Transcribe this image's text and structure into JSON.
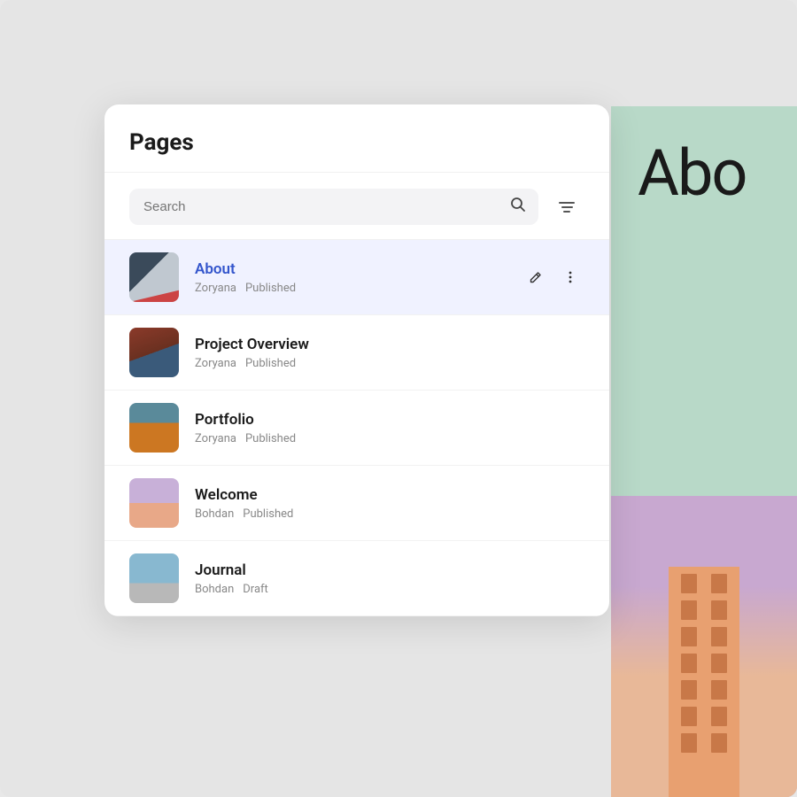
{
  "app": {
    "title": "Pages"
  },
  "search": {
    "placeholder": "Search",
    "value": ""
  },
  "pages": [
    {
      "id": "about",
      "name": "About",
      "author": "Zoryana",
      "status": "Published",
      "active": true,
      "thumbClass": "thumb-about"
    },
    {
      "id": "project-overview",
      "name": "Project Overview",
      "author": "Zoryana",
      "status": "Published",
      "active": false,
      "thumbClass": "thumb-project"
    },
    {
      "id": "portfolio",
      "name": "Portfolio",
      "author": "Zoryana",
      "status": "Published",
      "active": false,
      "thumbClass": "thumb-portfolio"
    },
    {
      "id": "welcome",
      "name": "Welcome",
      "author": "Bohdan",
      "status": "Published",
      "active": false,
      "thumbClass": "thumb-welcome"
    },
    {
      "id": "journal",
      "name": "Journal",
      "author": "Bohdan",
      "status": "Draft",
      "active": false,
      "thumbClass": "thumb-journal"
    }
  ],
  "right_panel": {
    "about_label": "Abo",
    "bg_color": "#b8d9c8",
    "bottom_color": "#c8a8d0"
  },
  "labels": {
    "pencil_icon": "pencil",
    "dots_icon": "more-options",
    "search_icon": "search",
    "filter_icon": "filter"
  }
}
